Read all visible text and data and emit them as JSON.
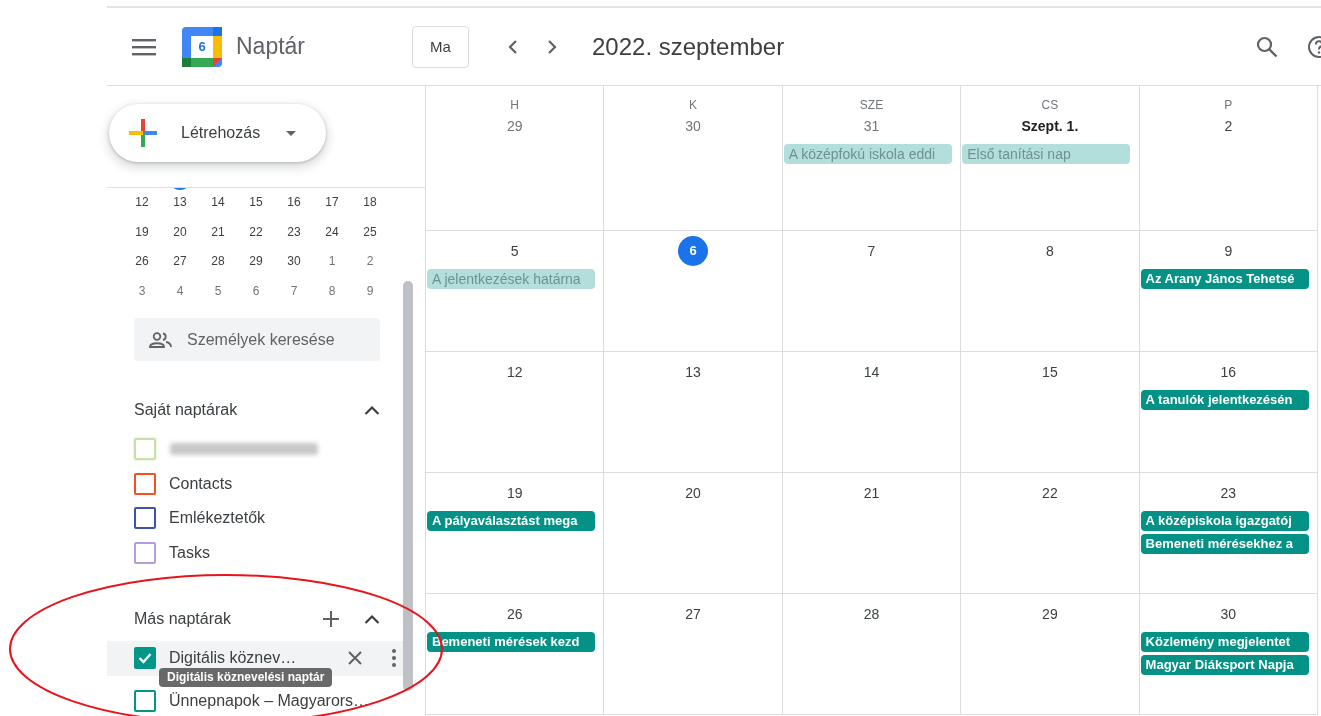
{
  "header": {
    "logo_day": "6",
    "app_title": "Naptár",
    "today_button": "Ma",
    "month_title": "2022. szeptember"
  },
  "create_button": {
    "label": "Létrehozás"
  },
  "mini_calendar": {
    "weeks": [
      [
        {
          "day": "12",
          "muted": false
        },
        {
          "day": "13",
          "muted": false
        },
        {
          "day": "14",
          "muted": false
        },
        {
          "day": "15",
          "muted": false
        },
        {
          "day": "16",
          "muted": false
        },
        {
          "day": "17",
          "muted": false
        },
        {
          "day": "18",
          "muted": false
        }
      ],
      [
        {
          "day": "19",
          "muted": false
        },
        {
          "day": "20",
          "muted": false
        },
        {
          "day": "21",
          "muted": false
        },
        {
          "day": "22",
          "muted": false
        },
        {
          "day": "23",
          "muted": false
        },
        {
          "day": "24",
          "muted": false
        },
        {
          "day": "25",
          "muted": false
        }
      ],
      [
        {
          "day": "26",
          "muted": false
        },
        {
          "day": "27",
          "muted": false
        },
        {
          "day": "28",
          "muted": false
        },
        {
          "day": "29",
          "muted": false
        },
        {
          "day": "30",
          "muted": false
        },
        {
          "day": "1",
          "muted": true
        },
        {
          "day": "2",
          "muted": true
        }
      ],
      [
        {
          "day": "3",
          "muted": true
        },
        {
          "day": "4",
          "muted": true
        },
        {
          "day": "5",
          "muted": true
        },
        {
          "day": "6",
          "muted": true
        },
        {
          "day": "7",
          "muted": true
        },
        {
          "day": "8",
          "muted": true
        },
        {
          "day": "9",
          "muted": true
        }
      ]
    ]
  },
  "people_search": {
    "placeholder": "Személyek keresése"
  },
  "my_calendars": {
    "title": "Saját naptárak",
    "expanded": true,
    "items": [
      {
        "kind": "redacted",
        "color": "#c5e1a5",
        "checked": false
      },
      {
        "kind": "calendar",
        "label": "Contacts",
        "color": "#f4511e",
        "checked": false
      },
      {
        "kind": "calendar",
        "label": "Emlékeztetők",
        "color": "#3f51b5",
        "checked": false
      },
      {
        "kind": "calendar",
        "label": "Tasks",
        "color": "#b39ddb",
        "checked": false
      }
    ]
  },
  "other_calendars": {
    "title": "Más naptárak",
    "expanded": true,
    "items": [
      {
        "kind": "calendar",
        "label": "Digitális köznev…",
        "color": "#009688",
        "checked": true,
        "hovered": true
      },
      {
        "kind": "calendar",
        "label": "Ünnepnapok – Magyarors…",
        "color": "#009688",
        "checked": false,
        "hovered": false
      }
    ]
  },
  "tooltip": "Digitális köznevelési naptár",
  "weekdays": [
    "H",
    "K",
    "SZE",
    "CS",
    "P"
  ],
  "weeks": [
    [
      {
        "day": "29",
        "kind": "other_month"
      },
      {
        "day": "30",
        "kind": "other_month"
      },
      {
        "day": "31",
        "kind": "other_month",
        "events": [
          {
            "title": "A középfokú iskola eddi",
            "past": true
          }
        ]
      },
      {
        "day": "Szept. 1.",
        "kind": "month_start",
        "events": [
          {
            "title": "Első tanítási nap",
            "past": true
          }
        ]
      },
      {
        "day": "2",
        "kind": "normal"
      }
    ],
    [
      {
        "day": "5",
        "kind": "normal",
        "events": [
          {
            "title": "A jelentkezések határna",
            "past": true
          }
        ]
      },
      {
        "day": "6",
        "kind": "today"
      },
      {
        "day": "7",
        "kind": "normal"
      },
      {
        "day": "8",
        "kind": "normal"
      },
      {
        "day": "9",
        "kind": "normal",
        "events": [
          {
            "title": "Az Arany János Tehetsé",
            "past": false
          }
        ]
      }
    ],
    [
      {
        "day": "12",
        "kind": "normal"
      },
      {
        "day": "13",
        "kind": "normal"
      },
      {
        "day": "14",
        "kind": "normal"
      },
      {
        "day": "15",
        "kind": "normal"
      },
      {
        "day": "16",
        "kind": "normal",
        "events": [
          {
            "title": "A tanulók jelentkezésén",
            "past": false
          }
        ]
      }
    ],
    [
      {
        "day": "19",
        "kind": "normal",
        "events": [
          {
            "title": "A pályaválasztást mega",
            "past": false
          }
        ]
      },
      {
        "day": "20",
        "kind": "normal"
      },
      {
        "day": "21",
        "kind": "normal"
      },
      {
        "day": "22",
        "kind": "normal"
      },
      {
        "day": "23",
        "kind": "normal",
        "events": [
          {
            "title": "A középiskola igazgatój",
            "past": false
          },
          {
            "title": "Bemeneti mérésekhez a",
            "past": false
          }
        ]
      }
    ],
    [
      {
        "day": "26",
        "kind": "normal",
        "events": [
          {
            "title": "Bemeneti mérések kezd",
            "past": false
          }
        ]
      },
      {
        "day": "27",
        "kind": "normal"
      },
      {
        "day": "28",
        "kind": "normal"
      },
      {
        "day": "29",
        "kind": "normal"
      },
      {
        "day": "30",
        "kind": "normal",
        "events": [
          {
            "title": "Közlemény megjelentet",
            "past": false
          },
          {
            "title": "Magyar Diáksport Napja",
            "past": false
          }
        ]
      }
    ]
  ]
}
